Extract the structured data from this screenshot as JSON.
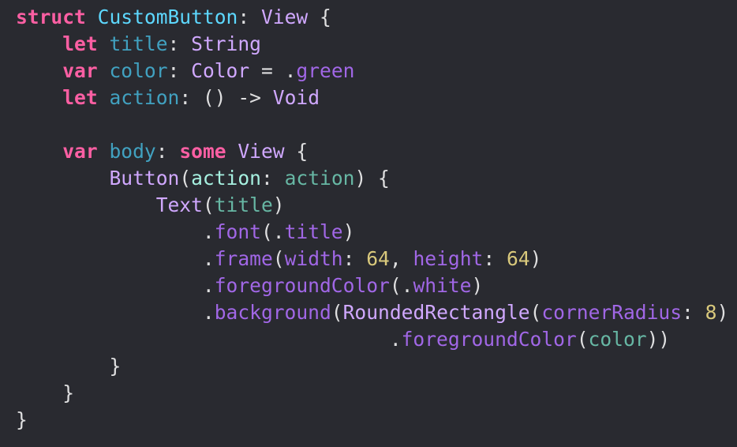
{
  "editor": {
    "colors": {
      "background": "#292A30",
      "keyword": "#FC5FA3",
      "declaration": "#5DD8FF",
      "type": "#D0A8FF",
      "property": "#41A1C0",
      "member": "#A167E6",
      "label": "#A6F0E0",
      "reference": "#67B7A4",
      "number": "#D9C97C",
      "plain": "#DFDFE0"
    },
    "lines": [
      [
        [
          "struct",
          "kw"
        ],
        [
          " ",
          "plain"
        ],
        [
          "CustomButton",
          "decl"
        ],
        [
          ": ",
          "plain"
        ],
        [
          "View",
          "type"
        ],
        [
          " {",
          "plain"
        ]
      ],
      [
        [
          "    ",
          "plain"
        ],
        [
          "let",
          "kw"
        ],
        [
          " ",
          "plain"
        ],
        [
          "title",
          "prop"
        ],
        [
          ": ",
          "plain"
        ],
        [
          "String",
          "type"
        ]
      ],
      [
        [
          "    ",
          "plain"
        ],
        [
          "var",
          "kw"
        ],
        [
          " ",
          "plain"
        ],
        [
          "color",
          "prop"
        ],
        [
          ": ",
          "plain"
        ],
        [
          "Color",
          "type"
        ],
        [
          " = .",
          "plain"
        ],
        [
          "green",
          "member"
        ]
      ],
      [
        [
          "    ",
          "plain"
        ],
        [
          "let",
          "kw"
        ],
        [
          " ",
          "plain"
        ],
        [
          "action",
          "prop"
        ],
        [
          ": () -> ",
          "plain"
        ],
        [
          "Void",
          "type"
        ]
      ],
      [],
      [
        [
          "    ",
          "plain"
        ],
        [
          "var",
          "kw"
        ],
        [
          " ",
          "plain"
        ],
        [
          "body",
          "prop"
        ],
        [
          ": ",
          "plain"
        ],
        [
          "some",
          "kw"
        ],
        [
          " ",
          "plain"
        ],
        [
          "View",
          "type"
        ],
        [
          " {",
          "plain"
        ]
      ],
      [
        [
          "        ",
          "plain"
        ],
        [
          "Button",
          "type"
        ],
        [
          "(",
          "plain"
        ],
        [
          "action",
          "label"
        ],
        [
          ": ",
          "plain"
        ],
        [
          "action",
          "ref"
        ],
        [
          ") {",
          "plain"
        ]
      ],
      [
        [
          "            ",
          "plain"
        ],
        [
          "Text",
          "type"
        ],
        [
          "(",
          "plain"
        ],
        [
          "title",
          "ref"
        ],
        [
          ")",
          "plain"
        ]
      ],
      [
        [
          "                .",
          "plain"
        ],
        [
          "font",
          "member"
        ],
        [
          "(.",
          "plain"
        ],
        [
          "title",
          "member"
        ],
        [
          ")",
          "plain"
        ]
      ],
      [
        [
          "                .",
          "plain"
        ],
        [
          "frame",
          "member"
        ],
        [
          "(",
          "plain"
        ],
        [
          "width",
          "member"
        ],
        [
          ": ",
          "plain"
        ],
        [
          "64",
          "num"
        ],
        [
          ", ",
          "plain"
        ],
        [
          "height",
          "member"
        ],
        [
          ": ",
          "plain"
        ],
        [
          "64",
          "num"
        ],
        [
          ")",
          "plain"
        ]
      ],
      [
        [
          "                .",
          "plain"
        ],
        [
          "foregroundColor",
          "member"
        ],
        [
          "(.",
          "plain"
        ],
        [
          "white",
          "member"
        ],
        [
          ")",
          "plain"
        ]
      ],
      [
        [
          "                .",
          "plain"
        ],
        [
          "background",
          "member"
        ],
        [
          "(",
          "plain"
        ],
        [
          "RoundedRectangle",
          "type"
        ],
        [
          "(",
          "plain"
        ],
        [
          "cornerRadius",
          "member"
        ],
        [
          ": ",
          "plain"
        ],
        [
          "8",
          "num"
        ],
        [
          ")",
          "plain"
        ]
      ],
      [
        [
          "                                .",
          "plain"
        ],
        [
          "foregroundColor",
          "member"
        ],
        [
          "(",
          "plain"
        ],
        [
          "color",
          "ref"
        ],
        [
          "))",
          "plain"
        ]
      ],
      [
        [
          "        }",
          "plain"
        ]
      ],
      [
        [
          "    }",
          "plain"
        ]
      ],
      [
        [
          "}",
          "plain"
        ]
      ]
    ]
  }
}
